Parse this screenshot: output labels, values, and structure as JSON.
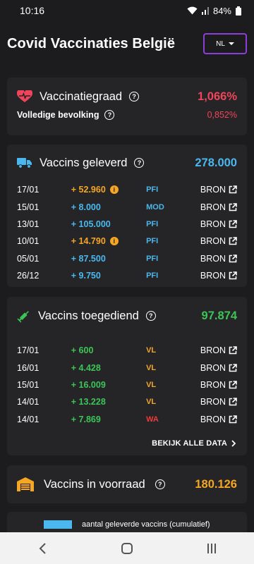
{
  "status": {
    "time": "10:16",
    "battery": "84%"
  },
  "header": {
    "title": "Covid Vaccinaties België",
    "lang": "NL"
  },
  "vaccinatiegraad": {
    "title": "Vaccinatiegraad",
    "value": "1,066%",
    "sub_label": "Volledige bevolking",
    "sub_value": "0,852%"
  },
  "geleverd": {
    "title": "Vaccins geleverd",
    "total": "278.000",
    "rows": [
      {
        "date": "17/01",
        "amount": "+ 52.960",
        "src": "PFI",
        "info": true,
        "amount_color": "orange",
        "src_color": "blue",
        "bron": "BRON"
      },
      {
        "date": "15/01",
        "amount": "+ 8.000",
        "src": "MOD",
        "info": false,
        "amount_color": "blue",
        "src_color": "blue",
        "bron": "BRON"
      },
      {
        "date": "13/01",
        "amount": "+ 105.000",
        "src": "PFI",
        "info": false,
        "amount_color": "blue",
        "src_color": "blue",
        "bron": "BRON"
      },
      {
        "date": "10/01",
        "amount": "+ 14.790",
        "src": "PFI",
        "info": true,
        "amount_color": "orange",
        "src_color": "blue",
        "bron": "BRON"
      },
      {
        "date": "05/01",
        "amount": "+ 87.500",
        "src": "PFI",
        "info": false,
        "amount_color": "blue",
        "src_color": "blue",
        "bron": "BRON"
      },
      {
        "date": "26/12",
        "amount": "+ 9.750",
        "src": "PFI",
        "info": false,
        "amount_color": "blue",
        "src_color": "blue",
        "bron": "BRON"
      }
    ]
  },
  "toegediend": {
    "title": "Vaccins toegediend",
    "total": "97.874",
    "rows": [
      {
        "date": "17/01",
        "amount": "+ 600",
        "src": "VL",
        "src_color": "orange",
        "bron": "BRON"
      },
      {
        "date": "16/01",
        "amount": "+ 4.428",
        "src": "VL",
        "src_color": "orange",
        "bron": "BRON"
      },
      {
        "date": "15/01",
        "amount": "+ 16.009",
        "src": "VL",
        "src_color": "orange",
        "bron": "BRON"
      },
      {
        "date": "14/01",
        "amount": "+ 13.228",
        "src": "VL",
        "src_color": "orange",
        "bron": "BRON"
      },
      {
        "date": "14/01",
        "amount": "+ 7.869",
        "src": "WA",
        "src_color": "darkred",
        "bron": "BRON"
      }
    ],
    "link": "BEKIJK ALLE DATA"
  },
  "voorraad": {
    "title": "Vaccins in voorraad",
    "total": "180.126"
  },
  "legend": {
    "label": "aantal geleverde vaccins (cumulatief)",
    "color": "#4ab8ee"
  },
  "colors": {
    "red": "#f0445a",
    "blue": "#4ab8ee",
    "green": "#3cc457",
    "orange": "#f5a623",
    "purple": "#8b3fd9"
  }
}
